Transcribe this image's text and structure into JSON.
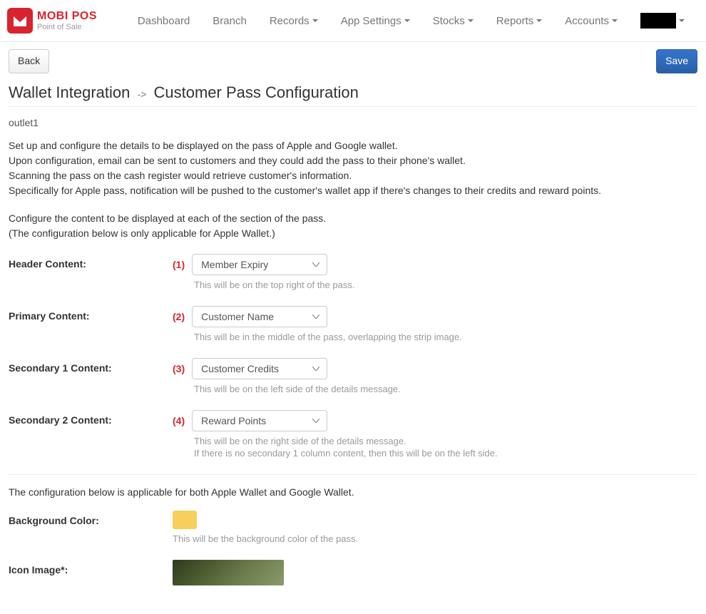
{
  "brand": {
    "title": "MOBI POS",
    "subtitle": "Point of Sale"
  },
  "nav": {
    "dashboard": "Dashboard",
    "branch": "Branch",
    "records": "Records",
    "appSettings": "App Settings",
    "stocks": "Stocks",
    "reports": "Reports",
    "accounts": "Accounts"
  },
  "buttons": {
    "back": "Back",
    "save": "Save"
  },
  "pageTitle": {
    "main": "Wallet Integration",
    "arrow": "->",
    "sub": "Customer Pass Configuration"
  },
  "outlet": "outlet1",
  "description": {
    "line1": "Set up and configure the details to be displayed on the pass of Apple and Google wallet.",
    "line2": "Upon configuration, email can be sent to customers and they could add the pass to their phone's wallet.",
    "line3": "Scanning the pass on the cash register would retrieve customer's information.",
    "line4": "Specifically for Apple pass, notification will be pushed to the customer's wallet app if there's changes to their credits and reward points.",
    "line5": "Configure the content to be displayed at each of the section of the pass.",
    "line6": "(The configuration below is only applicable for Apple Wallet.)"
  },
  "fields": {
    "header": {
      "label": "Header Content:",
      "number": "(1)",
      "value": "Member Expiry",
      "help": "This will be on the top right of the pass."
    },
    "primary": {
      "label": "Primary Content:",
      "number": "(2)",
      "value": "Customer Name",
      "help": "This will be in the middle of the pass, overlapping the strip image."
    },
    "secondary1": {
      "label": "Secondary 1 Content:",
      "number": "(3)",
      "value": "Customer Credits",
      "help": "This will be on the left side of the details message."
    },
    "secondary2": {
      "label": "Secondary 2 Content:",
      "number": "(4)",
      "value": "Reward Points",
      "help1": "This will be on the right side of the details message.",
      "help2": "If there is no secondary 1 column content, then this will be on the left side."
    },
    "bothNote": "The configuration below is applicable for both Apple Wallet and Google Wallet.",
    "bgColor": {
      "label": "Background Color:",
      "hex": "#f7cf5d",
      "help": "This will be the background color of the pass."
    },
    "iconImage": {
      "label": "Icon Image*:"
    }
  }
}
